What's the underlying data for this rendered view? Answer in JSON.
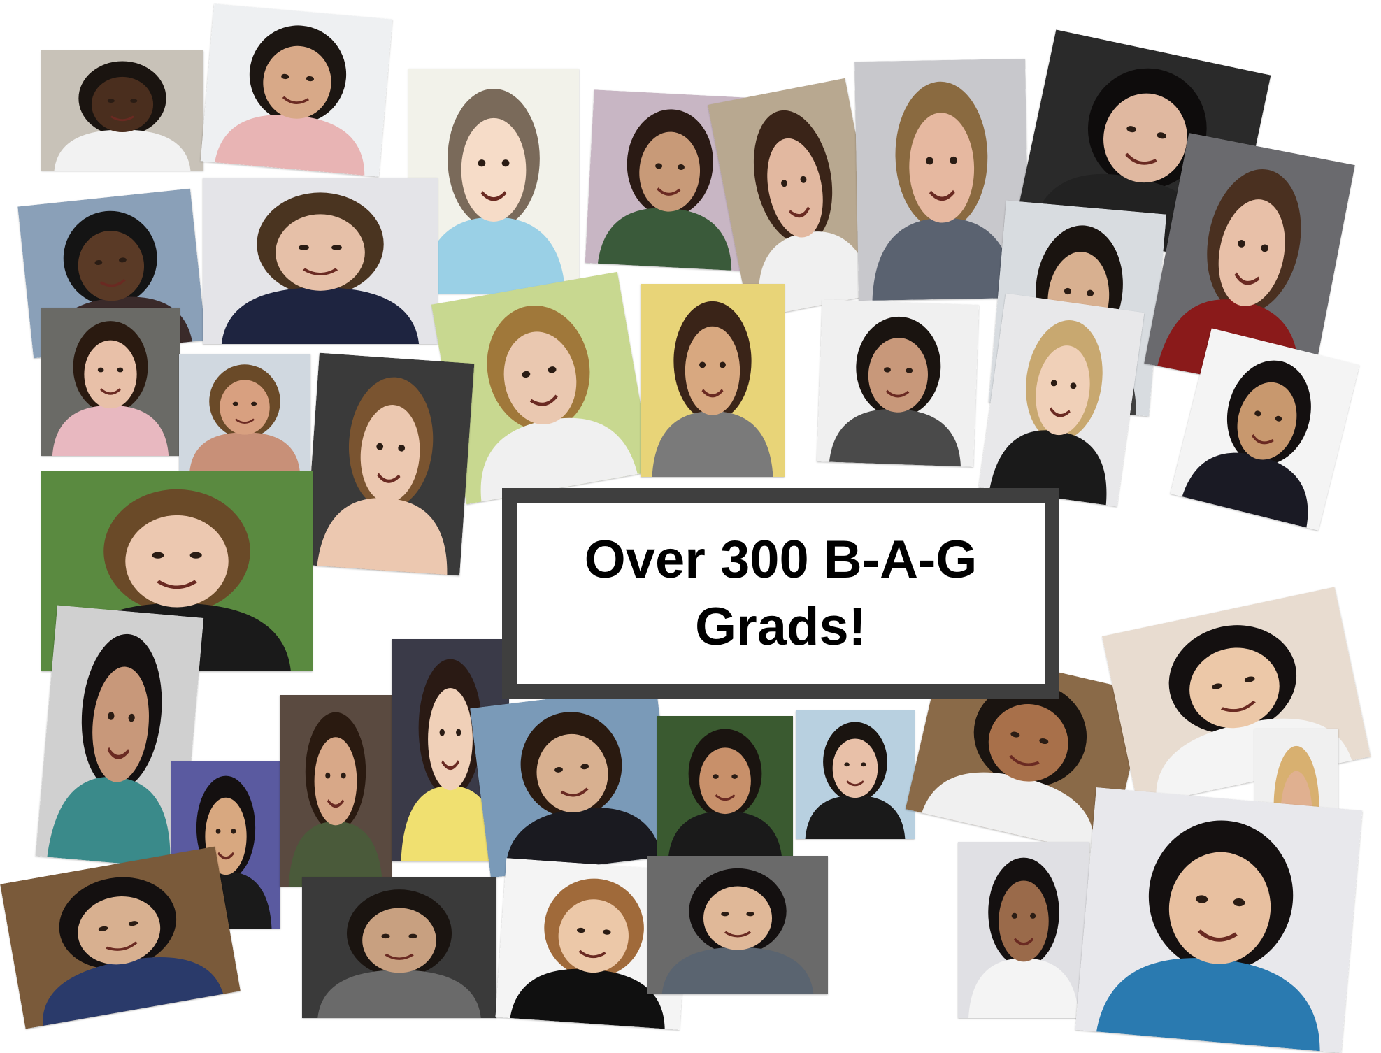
{
  "banner": {
    "line1": "Over 300 B-A-G",
    "line2": "Grads!"
  },
  "colors": {
    "background": "#ffffff",
    "banner_border": "#3f3f3f",
    "banner_text": "#000000"
  },
  "photos": [
    {
      "name": "photo-man-desk-globe",
      "bg": "#c8c2b8",
      "skin": "#4a2e1e",
      "hair": "#1a1410",
      "shirt": "#f2f2f2"
    },
    {
      "name": "photo-girl-smiling-dark-hair",
      "bg": "#eef0f2",
      "skin": "#d8a988",
      "hair": "#1c1612",
      "shirt": "#e8b4b4"
    },
    {
      "name": "photo-caricature-cat-ears",
      "bg": "#f2f2ea",
      "skin": "#f6dcc8",
      "hair": "#7a6a5a",
      "shirt": "#9ad0e6"
    },
    {
      "name": "photo-woman-blurry-scarf",
      "bg": "#c8b6c4",
      "skin": "#c89a78",
      "hair": "#2a1a14",
      "shirt": "#3a5a3a"
    },
    {
      "name": "photo-woman-long-dark-hair",
      "bg": "#b8a890",
      "skin": "#e2b8a0",
      "hair": "#3a2418",
      "shirt": "#f0f0f0"
    },
    {
      "name": "photo-young-man-blond",
      "bg": "#c8c8cc",
      "skin": "#e6b8a0",
      "hair": "#8a6a40",
      "shirt": "#5a6270"
    },
    {
      "name": "photo-girl-black-hair",
      "bg": "#2a2a2a",
      "skin": "#e0b8a0",
      "hair": "#0e0c0c",
      "shirt": "#222222"
    },
    {
      "name": "photo-man-window-sunglasses",
      "bg": "#8aa0b8",
      "skin": "#5a3a26",
      "hair": "#141414",
      "shirt": "#3a2a2a"
    },
    {
      "name": "photo-teen-lab-equipment",
      "bg": "#e4e4e8",
      "skin": "#e6c0a8",
      "hair": "#4a3420",
      "shirt": "#1e2440"
    },
    {
      "name": "photo-woman-flowers",
      "bg": "#c8d890",
      "skin": "#eac8b0",
      "hair": "#a0783a",
      "shirt": "#f0f0f0"
    },
    {
      "name": "photo-man-tie-yellow-wall",
      "bg": "#e8d478",
      "skin": "#d8a880",
      "hair": "#3a2418",
      "shirt": "#7a7a7a"
    },
    {
      "name": "photo-woman-white-wall",
      "bg": "#f0f0f0",
      "skin": "#c8987a",
      "hair": "#1a1410",
      "shirt": "#4a4a4a"
    },
    {
      "name": "photo-man-sunglasses-gray",
      "bg": "#d8dce0",
      "skin": "#d8b090",
      "hair": "#1a1410",
      "shirt": "#404040"
    },
    {
      "name": "photo-woman-living-room",
      "bg": "#6a6a6e",
      "skin": "#e8c0a8",
      "hair": "#4a3020",
      "shirt": "#8a1a1a"
    },
    {
      "name": "photo-young-man-black-shirt",
      "bg": "#e8e8ea",
      "skin": "#f0d0b8",
      "hair": "#c8a870",
      "shirt": "#1a1a1a"
    },
    {
      "name": "photo-young-man-suit-rose",
      "bg": "#f4f4f4",
      "skin": "#c8986e",
      "hair": "#141010",
      "shirt": "#1a1a24"
    },
    {
      "name": "photo-man-pink-shirt",
      "bg": "#6a6a66",
      "skin": "#e8c0a8",
      "hair": "#2a1a10",
      "shirt": "#e8b8c0"
    },
    {
      "name": "photo-man-mirror-sunglasses",
      "bg": "#d0d8e0",
      "skin": "#d8a080",
      "hair": "#6a4a28",
      "shirt": "#c89078"
    },
    {
      "name": "photo-woman-pearls",
      "bg": "#3a3a3a",
      "skin": "#ecc8b0",
      "hair": "#7a5430",
      "shirt": "#ecc8b0"
    },
    {
      "name": "photo-woman-park",
      "bg": "#5a8a40",
      "skin": "#ecc8b0",
      "hair": "#6a4a28",
      "shirt": "#1a1a1a"
    },
    {
      "name": "photo-woman-patterned-top",
      "bg": "#d0d0d0",
      "skin": "#c8987a",
      "hair": "#141010",
      "shirt": "#3a8a8a"
    },
    {
      "name": "photo-man-purple-wall",
      "bg": "#5a5aa0",
      "skin": "#d8a880",
      "hair": "#141010",
      "shirt": "#1a1a1a"
    },
    {
      "name": "photo-woman-dark-room",
      "bg": "#5a4a40",
      "skin": "#d8a888",
      "hair": "#2a1a10",
      "shirt": "#4a5a3a"
    },
    {
      "name": "photo-woman-yellow-top",
      "bg": "#3a3a48",
      "skin": "#f0d0b8",
      "hair": "#2a1a14",
      "shirt": "#f0e070"
    },
    {
      "name": "photo-man-lake",
      "bg": "#7a9ab8",
      "skin": "#d8b090",
      "hair": "#2a1a10",
      "shirt": "#1a1a20"
    },
    {
      "name": "photo-woman-green-trees",
      "bg": "#3a5a30",
      "skin": "#c8906a",
      "hair": "#1a1410",
      "shirt": "#1a1a1a"
    },
    {
      "name": "photo-woman-road",
      "bg": "#b8d0e0",
      "skin": "#e8c0a8",
      "hair": "#1a1410",
      "shirt": "#1a1a1a"
    },
    {
      "name": "photo-man-close-up",
      "bg": "#8a6a48",
      "skin": "#a8704a",
      "hair": "#1a1410",
      "shirt": "#f0f0f0"
    },
    {
      "name": "photo-man-glasses-close",
      "bg": "#e8dcd0",
      "skin": "#ecc8a8",
      "hair": "#141010",
      "shirt": "#f4f4f4"
    },
    {
      "name": "photo-woman-blonde",
      "bg": "#f0f0f0",
      "skin": "#e0b090",
      "hair": "#d8b070",
      "shirt": "#e8d050"
    },
    {
      "name": "photo-man-store",
      "bg": "#7a5a3a",
      "skin": "#d8b090",
      "hair": "#141010",
      "shirt": "#2a3a6a"
    },
    {
      "name": "photo-man-car-beard",
      "bg": "#3a3a3a",
      "skin": "#c8a080",
      "hair": "#1a1410",
      "shirt": "#6a6a6a"
    },
    {
      "name": "photo-woman-glasses-turtleneck",
      "bg": "#f4f4f4",
      "skin": "#ecc8a8",
      "hair": "#a06a3a",
      "shirt": "#101010"
    },
    {
      "name": "photo-young-man-chalkboard",
      "bg": "#6a6a6a",
      "skin": "#e0b898",
      "hair": "#141010",
      "shirt": "#5a6470"
    },
    {
      "name": "photo-woman-hand-chin",
      "bg": "#e0e0e4",
      "skin": "#9a6a4a",
      "hair": "#141010",
      "shirt": "#f4f4f4"
    },
    {
      "name": "photo-woman-blue-top",
      "bg": "#e8e8ec",
      "skin": "#e8c0a0",
      "hair": "#141010",
      "shirt": "#2a7ab0"
    }
  ]
}
